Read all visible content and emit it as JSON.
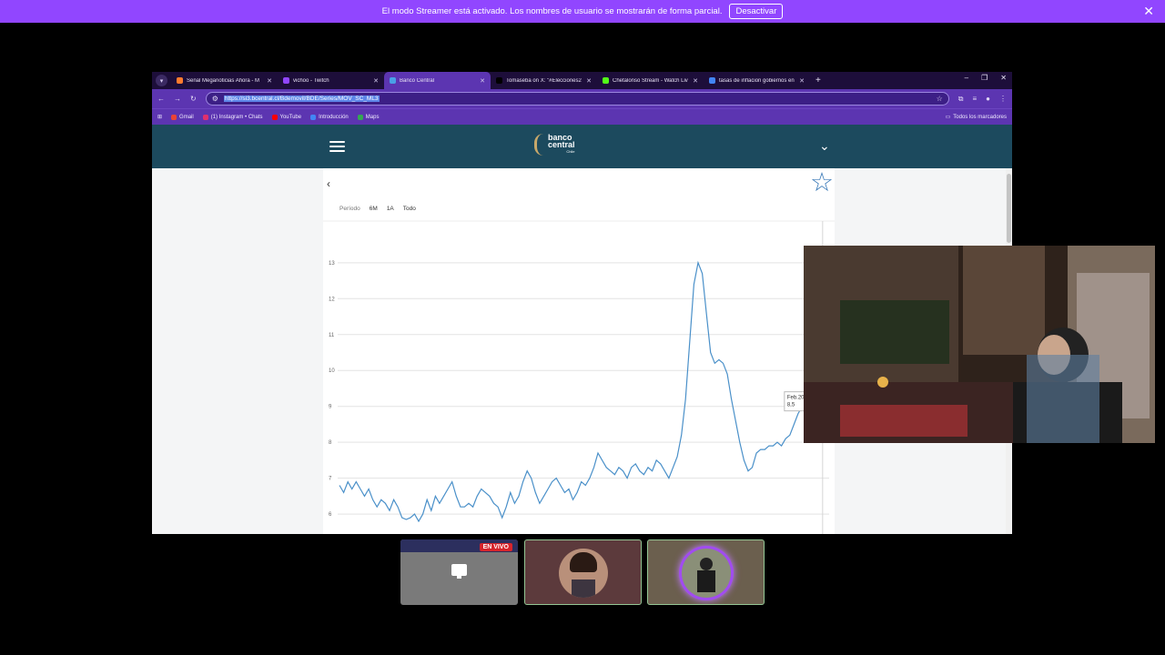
{
  "streamer_banner": {
    "message": "El modo Streamer está activado. Los nombres de usuario se mostrarán de forma parcial.",
    "button": "Desactivar",
    "close": "✕"
  },
  "browser": {
    "tabs": [
      {
        "title": "Señal Meganoticias Ahora - M",
        "color": "#ff7b2e",
        "active": false
      },
      {
        "title": "vichoo - Twitch",
        "color": "#9146ff",
        "active": false
      },
      {
        "title": "Banco Central",
        "color": "#4aa0e6",
        "active": true
      },
      {
        "title": "Tomaseba on X: \"#Elecciones2",
        "color": "#000000",
        "active": false
      },
      {
        "title": "Chetalonso Stream - Watch Liv",
        "color": "#53fc18",
        "active": false
      },
      {
        "title": "tasas de inflacion gobiernos en",
        "color": "#4285f4",
        "active": false
      }
    ],
    "new_tab": "+",
    "url": "https://si3.bcentral.cl/Bdemovil/BDE/Series/MOV_SC_ML3",
    "bookmarks": [
      {
        "label": "Gmail",
        "color": "#ea4335"
      },
      {
        "label": "(1) Instagram • Chats",
        "color": "#e1306c"
      },
      {
        "label": "YouTube",
        "color": "#ff0000"
      },
      {
        "label": "Introducción",
        "color": "#4285f4"
      },
      {
        "label": "Maps",
        "color": "#34a853"
      }
    ],
    "all_bookmarks": "Todos los marcadores"
  },
  "site": {
    "logo_line1": "banco",
    "logo_line2": "central",
    "logo_sub": "Chile",
    "period_label": "Período",
    "period_options": [
      "6M",
      "1A",
      "Todo"
    ],
    "back": "‹",
    "favorite": "☆"
  },
  "chart_data": {
    "type": "line",
    "title": "",
    "xlabel": "",
    "ylabel": "",
    "ylim": [
      6,
      13
    ],
    "yticks": [
      6,
      7,
      8,
      9,
      10,
      11,
      12,
      13
    ],
    "grid": true,
    "series_color": "#4a90c9",
    "values": [
      6.8,
      6.6,
      6.9,
      6.7,
      6.9,
      6.7,
      6.5,
      6.7,
      6.4,
      6.2,
      6.4,
      6.3,
      6.1,
      6.4,
      6.2,
      5.9,
      5.85,
      5.9,
      6.0,
      5.8,
      6.0,
      6.4,
      6.1,
      6.5,
      6.3,
      6.5,
      6.7,
      6.9,
      6.5,
      6.2,
      6.2,
      6.3,
      6.2,
      6.5,
      6.7,
      6.6,
      6.5,
      6.3,
      6.2,
      5.9,
      6.2,
      6.6,
      6.3,
      6.5,
      6.9,
      7.2,
      7.0,
      6.6,
      6.3,
      6.5,
      6.7,
      6.9,
      7.0,
      6.8,
      6.6,
      6.7,
      6.4,
      6.6,
      6.9,
      6.8,
      7.0,
      7.3,
      7.7,
      7.5,
      7.3,
      7.2,
      7.1,
      7.3,
      7.2,
      7.0,
      7.3,
      7.4,
      7.2,
      7.1,
      7.3,
      7.2,
      7.5,
      7.4,
      7.2,
      7.0,
      7.3,
      7.6,
      8.2,
      9.2,
      10.8,
      12.4,
      13.0,
      12.7,
      11.6,
      10.5,
      10.2,
      10.3,
      10.2,
      9.9,
      9.2,
      8.6,
      8.0,
      7.5,
      7.2,
      7.3,
      7.7,
      7.8,
      7.8,
      7.9,
      7.9,
      8.0,
      7.9,
      8.1,
      8.2,
      8.5,
      8.8,
      9.0,
      8.9,
      8.6,
      8.5,
      8.9,
      8.4,
      8.1
    ],
    "tooltip": {
      "label": "Feb.2024",
      "value": "8,5"
    },
    "tooltip_index": 115
  },
  "participants": {
    "live_badge": "EN VIVO"
  }
}
